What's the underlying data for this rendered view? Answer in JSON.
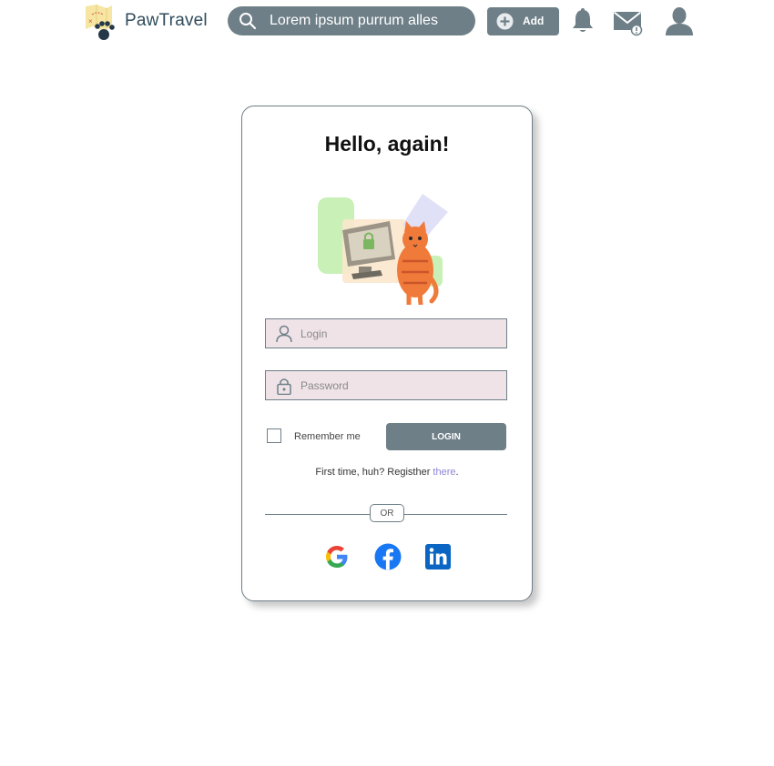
{
  "header": {
    "brand": "PawTravel",
    "search_placeholder": "Lorem ipsum purrum alles",
    "add_label": "Add"
  },
  "card": {
    "title": "Hello, again!",
    "login_placeholder": "Login",
    "password_placeholder": "Password",
    "remember_label": "Remember me",
    "login_button": "LOGIN",
    "register_prefix": "First time, huh? Registher ",
    "register_link": "there",
    "register_suffix": ".",
    "divider_label": "OR"
  },
  "icons": [
    "logo-map-paw",
    "search-icon",
    "plus-circle-icon",
    "bell-icon",
    "mail-alert-icon",
    "user-icon",
    "user-outline-icon",
    "padlock-icon",
    "google-icon",
    "facebook-icon",
    "linkedin-icon"
  ],
  "colors": {
    "accent": "#6e7f88",
    "field_bg": "#efe3e7",
    "link": "#8b86d6",
    "brand_text": "#2f4b5c"
  }
}
